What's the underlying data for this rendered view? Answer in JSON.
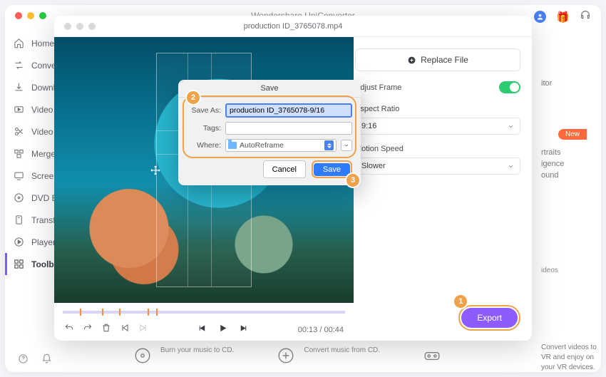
{
  "app": {
    "title": "Wondershare UniConverter"
  },
  "sidebar": {
    "items": [
      {
        "label": "Home"
      },
      {
        "label": "Converter"
      },
      {
        "label": "Downloader"
      },
      {
        "label": "Video Compressor"
      },
      {
        "label": "Video Editor"
      },
      {
        "label": "Merger"
      },
      {
        "label": "Screen Recorder"
      },
      {
        "label": "DVD Burner"
      },
      {
        "label": "Transfer"
      },
      {
        "label": "Player"
      },
      {
        "label": "Toolbox"
      }
    ]
  },
  "right_peek": {
    "title": "itor",
    "new_badge": "New",
    "line1": "rtraits",
    "line2": "igence",
    "line3": "ound",
    "videos": "ideos",
    "vr_desc": "Convert videos to VR and enjoy on your VR devices."
  },
  "bottom_tiles": {
    "burn": "Burn your music to CD.",
    "convert_cd": "Convert music from CD."
  },
  "editor": {
    "filename": "production ID_3765078.mp4",
    "replace_label": "Replace File",
    "adjust_frame_label": "Adjust Frame",
    "aspect_label": "Aspect Ratio",
    "aspect_value": "9:16",
    "motion_label": "Motion Speed",
    "motion_value": "Slower",
    "export_label": "Export",
    "time_current": "00:13",
    "time_total": "00:44"
  },
  "save_dialog": {
    "title": "Save",
    "save_as_lbl": "Save As:",
    "save_as_val": "production ID_3765078-9/16",
    "tags_lbl": "Tags:",
    "tags_val": "",
    "where_lbl": "Where:",
    "where_val": "AutoReframe",
    "cancel": "Cancel",
    "save": "Save"
  },
  "callouts": {
    "c1": "1",
    "c2": "2",
    "c3": "3"
  }
}
